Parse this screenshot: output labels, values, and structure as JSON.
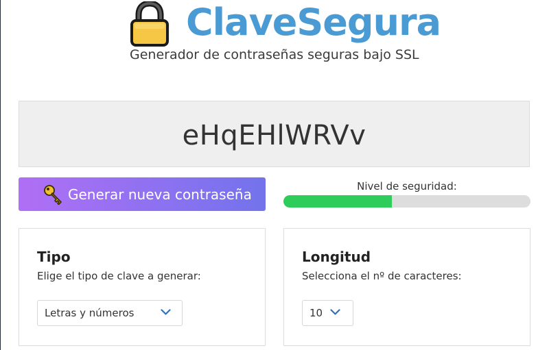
{
  "header": {
    "logo_icon": "lock-icon",
    "title": "ClaveSegura",
    "subtitle": "Generador de contraseñas seguras bajo SSL"
  },
  "password": {
    "value": "eHqEHlWRVv"
  },
  "generate_button": {
    "icon": "key-icon",
    "label": "Generar nueva contraseña"
  },
  "security": {
    "label": "Nivel de seguridad:",
    "level_fraction": 0.44,
    "fill_color": "#2ecc5a"
  },
  "type_card": {
    "title": "Tipo",
    "description": "Elige el tipo de clave a generar:",
    "selected": "Letras y números"
  },
  "length_card": {
    "title": "Longitud",
    "description": "Selecciona el nº de caracteres:",
    "selected": "10"
  },
  "colors": {
    "brand": "#4a9ad4",
    "button_gradient_start": "#b06ff5",
    "button_gradient_end": "#7373ec",
    "chevron": "#2f6fbf"
  }
}
